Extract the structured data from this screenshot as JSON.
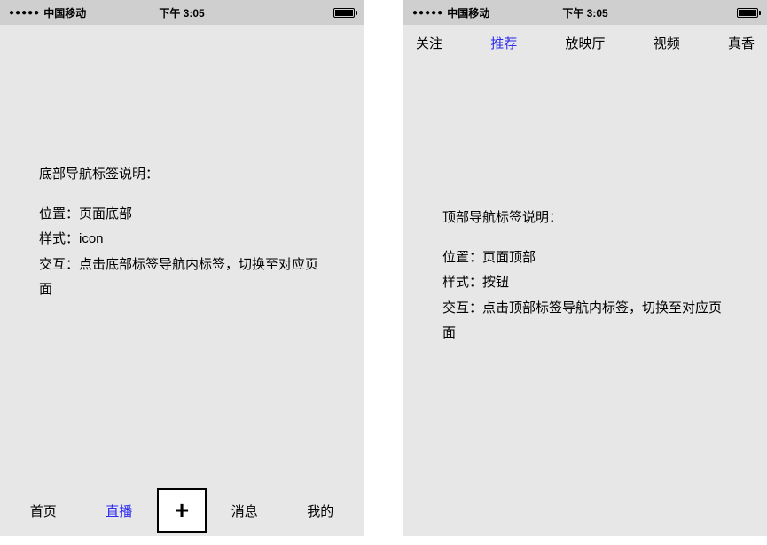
{
  "status_bar": {
    "carrier": "中国移动",
    "signal": "●●●●●",
    "time": "下午 3:05"
  },
  "left_phone": {
    "content": {
      "heading": "底部导航标签说明：",
      "line_position": "位置：页面底部",
      "line_style": "样式：icon",
      "line_interaction": "交互：点击底部标签导航内标签，切换至对应页面"
    },
    "bottom_tabs": {
      "items": [
        {
          "label": "首页"
        },
        {
          "label": "直播"
        },
        {
          "label": "消息"
        },
        {
          "label": "我的"
        }
      ],
      "plus": "+",
      "active_index": 1
    }
  },
  "right_phone": {
    "top_tabs": {
      "items": [
        {
          "label": "关注"
        },
        {
          "label": "推荐"
        },
        {
          "label": "放映厅"
        },
        {
          "label": "视频"
        },
        {
          "label": "真香"
        }
      ],
      "active_index": 1
    },
    "content": {
      "heading": "顶部导航标签说明：",
      "line_position": "位置：页面顶部",
      "line_style": "样式：按钮",
      "line_interaction": "交互：点击顶部标签导航内标签，切换至对应页面"
    }
  }
}
